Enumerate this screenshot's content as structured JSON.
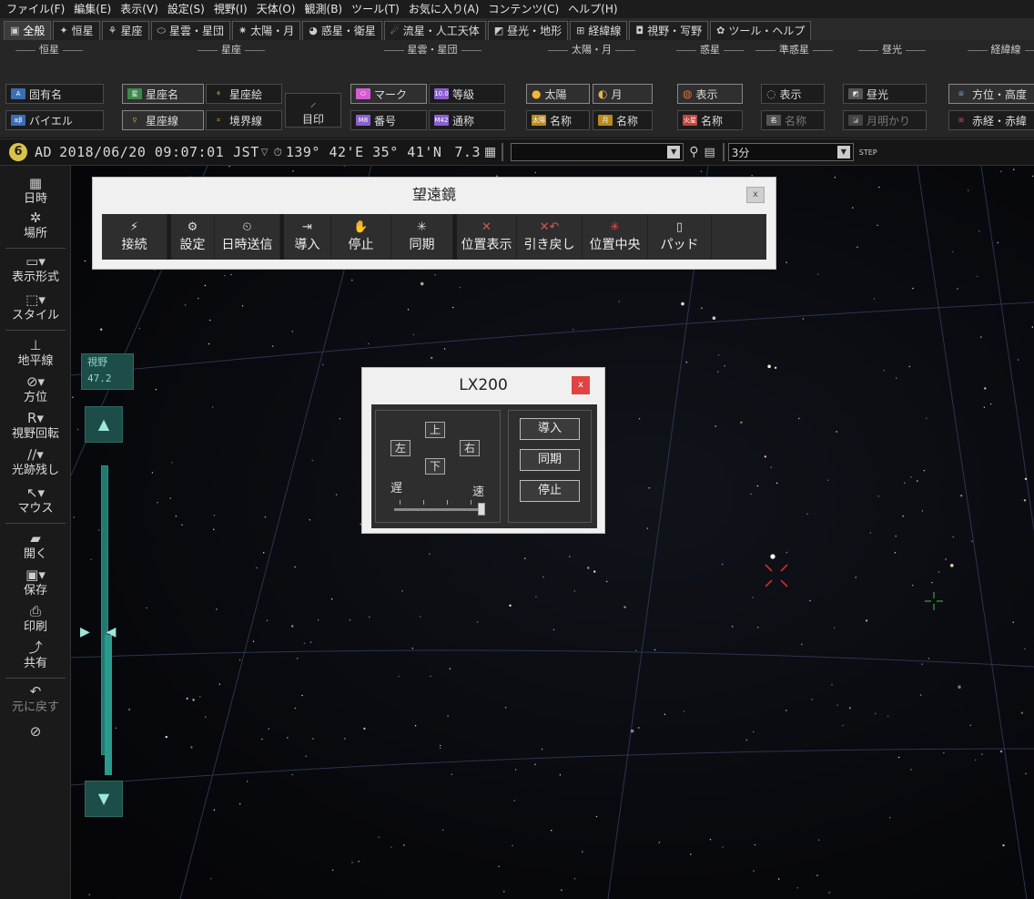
{
  "menu": [
    "ファイル(F)",
    "編集(E)",
    "表示(V)",
    "設定(S)",
    "視野(I)",
    "天体(O)",
    "観測(B)",
    "ツール(T)",
    "お気に入り(A)",
    "コンテンツ(C)",
    "ヘルプ(H)"
  ],
  "tabs": [
    "全般",
    "恒星",
    "星座",
    "星雲・星団",
    "太陽・月",
    "惑星・衛星",
    "流星・人工天体",
    "昼光・地形",
    "経緯線",
    "視野・写野",
    "ツール・ヘルプ"
  ],
  "ribbon": {
    "groups": [
      "恒星",
      "星座",
      "星雲・星団",
      "太陽・月",
      "惑星",
      "準惑星",
      "昼光",
      "経緯線"
    ],
    "stars": [
      "固有名",
      "バイエル"
    ],
    "constellation": [
      "星座名",
      "星座絵",
      "星座線",
      "境界線",
      "目印"
    ],
    "nebula": [
      "マーク",
      "等級",
      "番号",
      "通称"
    ],
    "sun_moon": [
      "太陽",
      "月",
      "名称",
      "名称"
    ],
    "planet": [
      "表示",
      "名称"
    ],
    "dwarf": [
      "表示",
      "名称"
    ],
    "daylight": [
      "昼光",
      "月明かり"
    ],
    "grid": [
      "方位・高度",
      "赤経・赤緯"
    ]
  },
  "status": {
    "era": "AD",
    "datetime": "2018/06/20 09:07:01",
    "tz": "JST",
    "coords": "139° 42'E 35° 41'N",
    "elev": "7.3",
    "step": "3分"
  },
  "left": [
    "日時",
    "場所",
    "表示形式",
    "スタイル",
    "地平線",
    "方位",
    "視野回転",
    "光跡残し",
    "マウス",
    "開く",
    "保存",
    "印刷",
    "共有",
    "元に戻す"
  ],
  "fov": {
    "label": "視野",
    "value": "47.2"
  },
  "scope": {
    "title": "望遠鏡",
    "close": "x",
    "buttons": [
      "接続",
      "設定",
      "日時送信",
      "導入",
      "停止",
      "同期",
      "位置表示",
      "引き戻し",
      "位置中央",
      "パッド"
    ]
  },
  "lx": {
    "title": "LX200",
    "close": "x",
    "up": "上",
    "down": "下",
    "left": "左",
    "right": "右",
    "slow": "遅",
    "fast": "速",
    "cmds": [
      "導入",
      "同期",
      "停止"
    ]
  }
}
